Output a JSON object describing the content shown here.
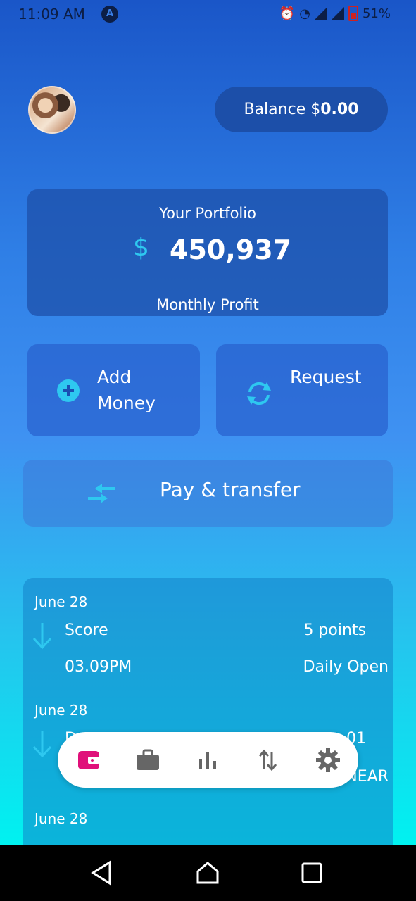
{
  "status_bar": {
    "time": "11:09 AM",
    "battery": "51%"
  },
  "header": {
    "balance_label": "Balance $",
    "balance_value": "0.00"
  },
  "portfolio": {
    "title": "Your Portfolio",
    "currency": "$",
    "amount": "450,937",
    "subtitle": "Monthly Profit"
  },
  "actions": {
    "add_money": "Add Money",
    "request": "Request",
    "pay_transfer": "Pay & transfer"
  },
  "transactions": [
    {
      "date": "June 28",
      "name": "Score",
      "value": "5 points",
      "time": "03.09PM",
      "category": "Daily Open"
    },
    {
      "date": "June 28",
      "name": "D",
      "value": "01",
      "time": "",
      "category": "NEAR"
    },
    {
      "date": "June 28",
      "name": "",
      "value": "",
      "time": "",
      "category": ""
    }
  ],
  "bottom_nav": {
    "items": [
      "wallet-icon",
      "briefcase-icon",
      "bar-chart-icon",
      "transfer-arrows-icon",
      "gear-icon"
    ],
    "active_color": "#e0107a",
    "inactive_color": "#666666"
  }
}
